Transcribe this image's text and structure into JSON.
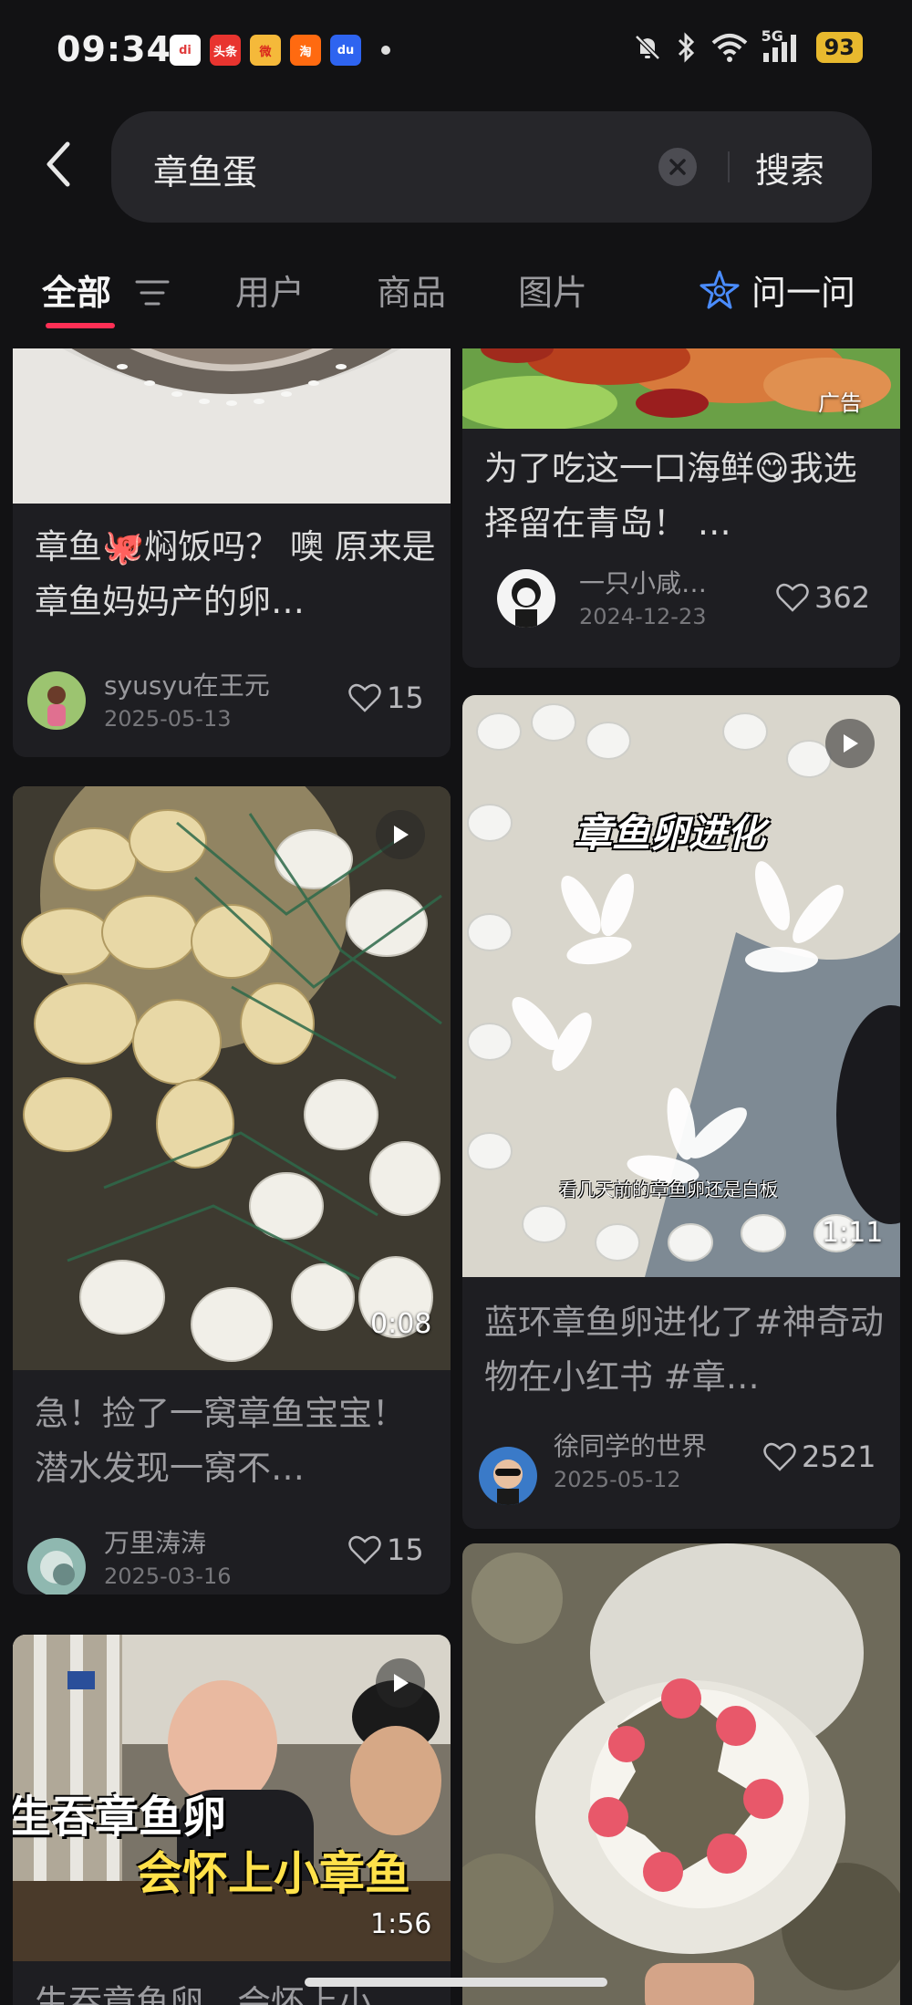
{
  "status": {
    "time": "09:34",
    "battery": "93",
    "network": "5G",
    "app_icons": [
      {
        "label": "di",
        "color": "#ffffff",
        "text_color": "#e03c3c"
      },
      {
        "label": "头条",
        "color": "#e8342f",
        "text_color": "#ffffff"
      },
      {
        "label": "微",
        "color": "#f5b93a",
        "text_color": "#d9261c"
      },
      {
        "label": "淘",
        "color": "#ff6a10",
        "text_color": "#ffffff"
      },
      {
        "label": "du",
        "color": "#2e64f0",
        "text_color": "#ffffff"
      }
    ]
  },
  "search": {
    "query": "章鱼蛋",
    "button": "搜索"
  },
  "tabs": [
    {
      "label": "全部",
      "active": true
    },
    {
      "label": "用户",
      "active": false
    },
    {
      "label": "商品",
      "active": false
    },
    {
      "label": "图片",
      "active": false
    }
  ],
  "ask_label": "问一问",
  "cards": {
    "l1": {
      "title": "章鱼🐙焖饭吗？ 噢 原来是章鱼妈妈产的卵…",
      "user": "syusyu在王元",
      "date": "2025-05-13",
      "likes": "15"
    },
    "l2": {
      "title": "急！捡了一窝章鱼宝宝！ 潜水发现一窝不…",
      "user": "万里涛涛",
      "date": "2025-03-16",
      "likes": "15",
      "duration": "0:08"
    },
    "l3": {
      "overlay1": "生吞章鱼卵",
      "overlay2": "会怀上小章鱼",
      "duration": "1:56",
      "title": "生吞章鱼卵，会怀上小…"
    },
    "r1": {
      "ad": "广告",
      "title": "为了吃这一口海鲜😋我选择留在青岛！ …",
      "user": "一只小咸…",
      "date": "2024-12-23",
      "likes": "362"
    },
    "r2": {
      "overlay_title": "章鱼卵进化",
      "caption": "看几天前的章鱼卵还是白板",
      "duration": "1:11",
      "title": "蓝环章鱼卵进化了#神奇动物在小红书 #章…",
      "user": "徐同学的世界",
      "date": "2025-05-12",
      "likes": "2521"
    }
  }
}
